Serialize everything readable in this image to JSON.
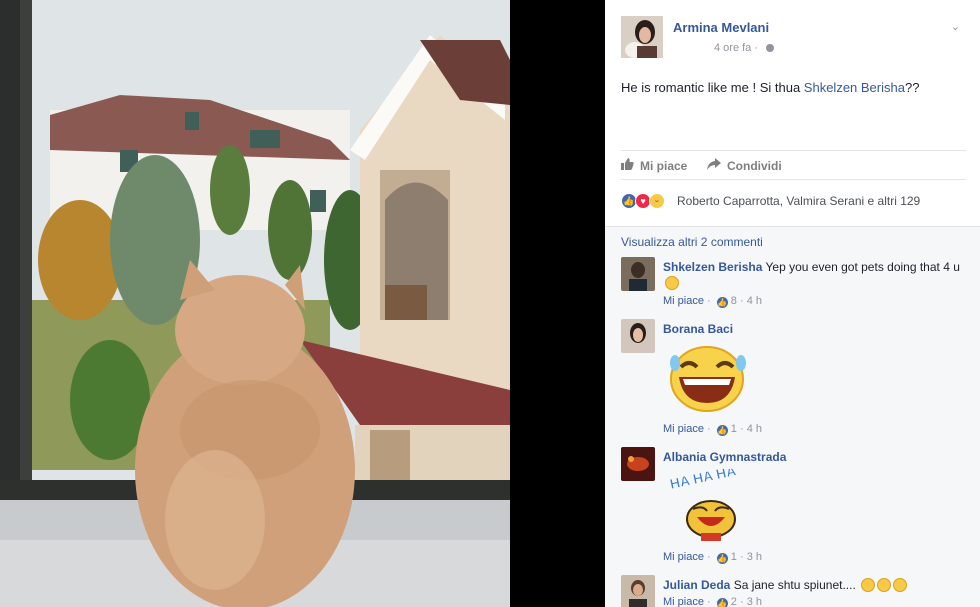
{
  "post": {
    "author": "Armina Mevlani",
    "time": "4 ore fa",
    "text_prefix": "He is romantic like me ! Si thua ",
    "tagged": "Shkelzen Berisha",
    "text_suffix": "??",
    "actions": {
      "like": "Mi piace",
      "share": "Condividi"
    },
    "reactions_text": "Roberto Caparrotta, Valmira Serani e altri 129"
  },
  "comments": {
    "more_link": "Visualizza altri 2 commenti",
    "items": [
      {
        "name": "Shkelzen Berisha",
        "text": "Yep you even got pets doing that 4 u",
        "like_label": "Mi piace",
        "likes": "8",
        "time": "4 h"
      },
      {
        "name": "Borana Baci",
        "text": "",
        "like_label": "Mi piace",
        "likes": "1",
        "time": "4 h",
        "sticker": "laughing-emoji-sticker"
      },
      {
        "name": "Albania Gymnastrada",
        "text": "",
        "like_label": "Mi piace",
        "likes": "1",
        "time": "3 h",
        "sticker": "hahaha-sticker",
        "sticker_text": "HA HA HA"
      },
      {
        "name": "Julian Deda",
        "text": "Sa jane shtu spiunet....",
        "like_label": "Mi piace",
        "likes": "2",
        "time": "3 h"
      }
    ]
  },
  "colors": {
    "link": "#365899",
    "muted": "#90949c",
    "like_blue": "#4267b2",
    "love_red": "#f0284a",
    "haha_yellow": "#f7c948"
  }
}
